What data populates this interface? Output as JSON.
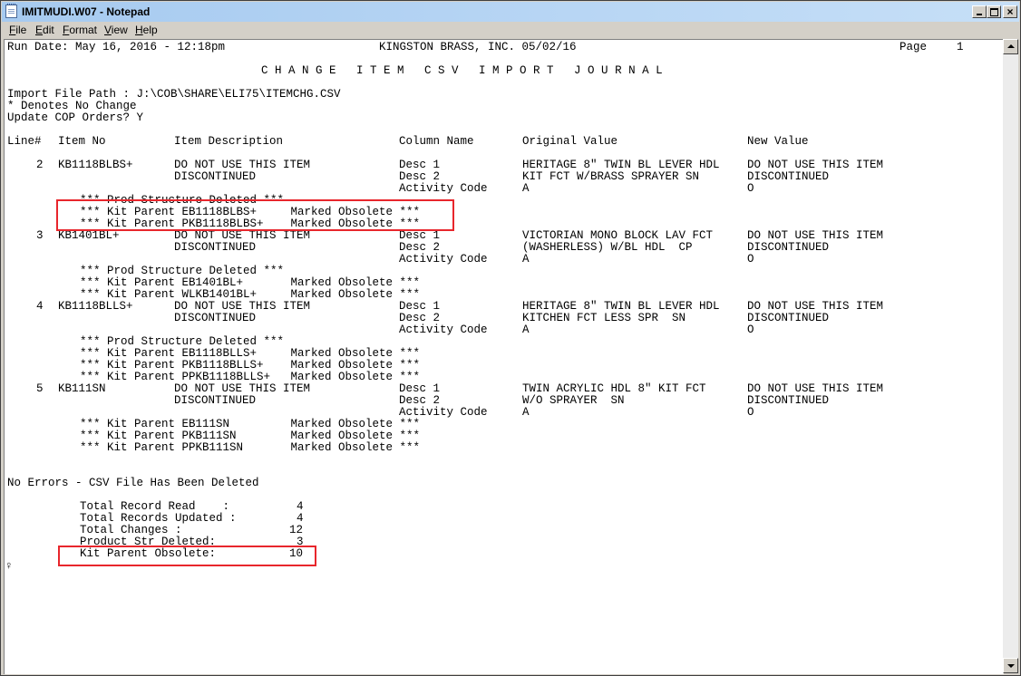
{
  "window": {
    "title": "IMITMUDI.W07 - Notepad"
  },
  "menu": {
    "items": [
      {
        "name": "File",
        "accel": "F",
        "rest": "ile"
      },
      {
        "name": "Edit",
        "accel": "E",
        "rest": "dit"
      },
      {
        "name": "Format",
        "accel": "F",
        "rest": "ormat"
      },
      {
        "name": "View",
        "accel": "V",
        "rest": "iew"
      },
      {
        "name": "Help",
        "accel": "H",
        "rest": "elp"
      }
    ]
  },
  "document": {
    "header": {
      "run_date": "Run Date: May 16, 2016 - 12:18pm",
      "company": "KINGSTON BRASS, INC. 05/02/16",
      "page_label": "Page",
      "page_number": "1",
      "report_title": "C H A N G E   I T E M   C S V   I M P O R T   J O U R N A L"
    },
    "info": {
      "import_path": "Import File Path : J:\\COB\\SHARE\\ELI75\\ITEMCHG.CSV",
      "no_change_note": "* Denotes No Change",
      "update_orders": "Update COP Orders? Y"
    },
    "columns": {
      "line": "Line#",
      "item_no": "Item No",
      "desc": "Item Description",
      "column_name": "Column Name",
      "original": "Original Value",
      "new": "New Value"
    },
    "records": [
      {
        "line": "2",
        "item": "KB1118BLBS+",
        "rows": [
          {
            "desc": "DO NOT USE THIS ITEM",
            "col": "Desc 1",
            "orig": "HERITAGE 8\" TWIN BL LEVER HDL",
            "new": "DO NOT USE THIS ITEM"
          },
          {
            "desc": "DISCONTINUED",
            "col": "Desc 2",
            "orig": "KIT FCT W/BRASS SPRAYER SN",
            "new": "DISCONTINUED"
          },
          {
            "desc": "",
            "col": "Activity Code",
            "orig": "A",
            "new": "O"
          }
        ],
        "notes": [
          "*** Prod Structure Deleted ***",
          "*** Kit Parent EB1118BLBS+     Marked Obsolete ***",
          "*** Kit Parent PKB1118BLBS+    Marked Obsolete ***"
        ]
      },
      {
        "line": "3",
        "item": "KB1401BL+",
        "rows": [
          {
            "desc": "DO NOT USE THIS ITEM",
            "col": "Desc 1",
            "orig": "VICTORIAN MONO BLOCK LAV FCT",
            "new": "DO NOT USE THIS ITEM"
          },
          {
            "desc": "DISCONTINUED",
            "col": "Desc 2",
            "orig": "(WASHERLESS) W/BL HDL  CP",
            "new": "DISCONTINUED"
          },
          {
            "desc": "",
            "col": "Activity Code",
            "orig": "A",
            "new": "O"
          }
        ],
        "notes": [
          "*** Prod Structure Deleted ***",
          "*** Kit Parent EB1401BL+       Marked Obsolete ***",
          "*** Kit Parent WLKB1401BL+     Marked Obsolete ***"
        ]
      },
      {
        "line": "4",
        "item": "KB1118BLLS+",
        "rows": [
          {
            "desc": "DO NOT USE THIS ITEM",
            "col": "Desc 1",
            "orig": "HERITAGE 8\" TWIN BL LEVER HDL",
            "new": "DO NOT USE THIS ITEM"
          },
          {
            "desc": "DISCONTINUED",
            "col": "Desc 2",
            "orig": "KITCHEN FCT LESS SPR  SN",
            "new": "DISCONTINUED"
          },
          {
            "desc": "",
            "col": "Activity Code",
            "orig": "A",
            "new": "O"
          }
        ],
        "notes": [
          "*** Prod Structure Deleted ***",
          "*** Kit Parent EB1118BLLS+     Marked Obsolete ***",
          "*** Kit Parent PKB1118BLLS+    Marked Obsolete ***",
          "*** Kit Parent PPKB1118BLLS+   Marked Obsolete ***"
        ]
      },
      {
        "line": "5",
        "item": "KB111SN",
        "rows": [
          {
            "desc": "DO NOT USE THIS ITEM",
            "col": "Desc 1",
            "orig": "TWIN ACRYLIC HDL 8\" KIT FCT",
            "new": "DO NOT USE THIS ITEM"
          },
          {
            "desc": "DISCONTINUED",
            "col": "Desc 2",
            "orig": "W/O SPRAYER  SN",
            "new": "DISCONTINUED"
          },
          {
            "desc": "",
            "col": "Activity Code",
            "orig": "A",
            "new": "O"
          }
        ],
        "notes": [
          "*** Kit Parent EB111SN         Marked Obsolete ***",
          "*** Kit Parent PKB111SN        Marked Obsolete ***",
          "*** Kit Parent PPKB111SN       Marked Obsolete ***"
        ]
      }
    ],
    "status": "No Errors - CSV File Has Been Deleted",
    "totals": [
      {
        "label": "Total Record Read    :",
        "value": "4"
      },
      {
        "label": "Total Records Updated :",
        "value": "4"
      },
      {
        "label": "Total Changes :",
        "value": "12"
      },
      {
        "label": "Product Str Deleted:",
        "value": "3"
      },
      {
        "label": "Kit Parent Obsolete:",
        "value": "10"
      }
    ],
    "end_mark": "♀"
  },
  "colors": {
    "highlight": "#e8262c",
    "titlebar": "#a6caf0"
  }
}
